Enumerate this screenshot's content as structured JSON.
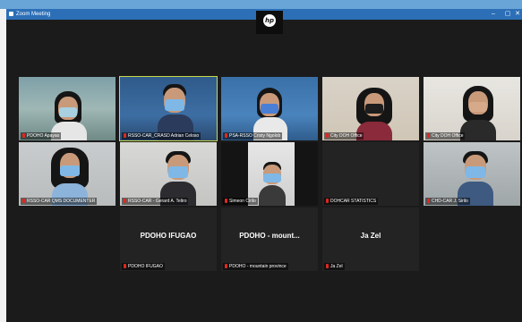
{
  "window": {
    "title": "Zoom Meeting",
    "controls": [
      "–",
      "▢",
      "✕"
    ]
  },
  "brand": {
    "logo_text": "hp"
  },
  "participants": [
    {
      "id": "p1",
      "name": "PDOHO Apayao",
      "active": false,
      "video": true
    },
    {
      "id": "p2",
      "name": "RSSO-CAR_CRASD Adrian Celoso",
      "active": true,
      "video": true
    },
    {
      "id": "p3",
      "name": "PSA-RSSO Cristy Ngolob",
      "active": false,
      "video": true
    },
    {
      "id": "p4",
      "name": "City DOH Office",
      "active": false,
      "video": true
    },
    {
      "id": "p5",
      "name": "City DOH Office",
      "active": false,
      "video": true
    },
    {
      "id": "p6",
      "name": "RSSO-CAR QMS DOCUMENTER",
      "active": false,
      "video": true
    },
    {
      "id": "p7",
      "name": "RSSO-CAR - Gerard A. Teliro",
      "active": false,
      "video": true
    },
    {
      "id": "p8",
      "name": "Simeon Cirilo",
      "active": false,
      "video": true
    },
    {
      "id": "p9",
      "name": "DOHCAR STATISTICS",
      "active": false,
      "video": false
    },
    {
      "id": "p10",
      "name": "CHD-CAR J. Sirilo",
      "active": false,
      "video": true
    },
    {
      "id": "p11",
      "name": "PDOHO IFUGAO",
      "display_name": "PDOHO IFUGAO",
      "active": false,
      "video": false
    },
    {
      "id": "p12",
      "name": "PDOHO - mountain province",
      "display_name": "PDOHO - mount...",
      "active": false,
      "video": false
    },
    {
      "id": "p13",
      "name": "Ja Zel",
      "display_name": "Ja Zel",
      "active": false,
      "video": false
    }
  ],
  "colors": {
    "titlebar": "#2c6fb7",
    "active_border": "#c9d84a",
    "mic_muted": "#e0281f"
  }
}
